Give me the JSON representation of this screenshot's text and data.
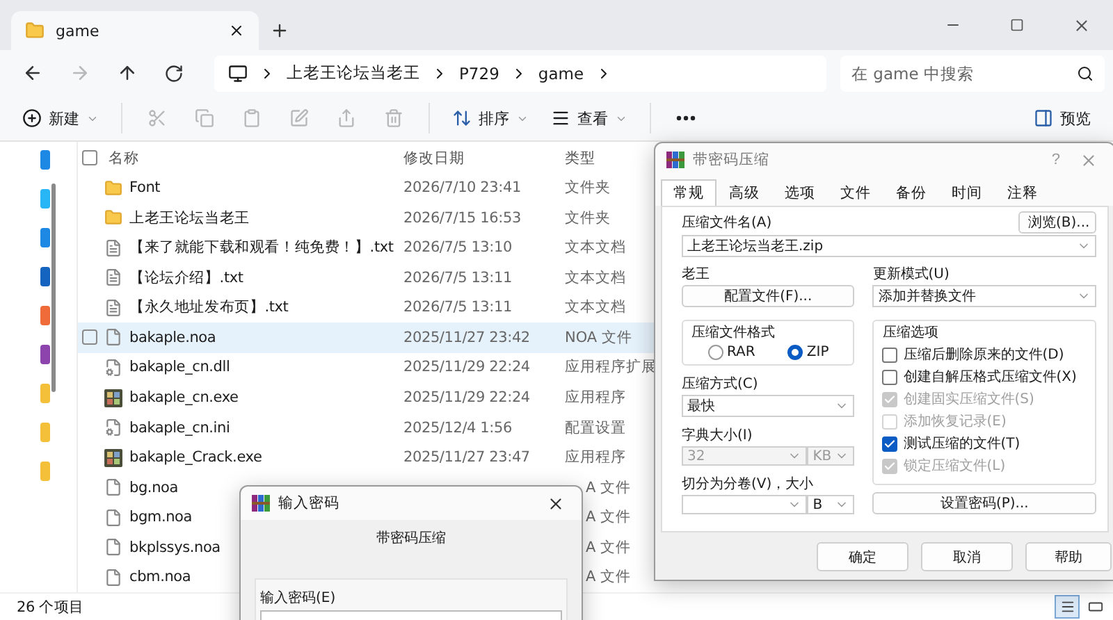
{
  "explorer": {
    "tab": {
      "title": "game"
    },
    "breadcrumb": [
      "上老王论坛当老王",
      "P729",
      "game"
    ],
    "search": {
      "placeholder": "在 game 中搜索"
    },
    "toolbar": {
      "new": "新建",
      "sort": "排序",
      "view": "查看",
      "preview": "预览"
    },
    "nav_pane": [
      {
        "color": "#1e88e5"
      },
      {
        "color": "#29b6f6"
      },
      {
        "color": "#1e88e5"
      },
      {
        "color": "#1565c0"
      },
      {
        "color": "#ef6c3a"
      },
      {
        "color": "#8e44ad"
      },
      {
        "color": "#f4c03a"
      },
      {
        "color": "#f4c03a"
      },
      {
        "color": "#f4c03a"
      }
    ],
    "select_all": {
      "checked": false
    },
    "columns": [
      "名称",
      "修改日期",
      "类型"
    ],
    "files": [
      {
        "kind": "folder",
        "name": "Font",
        "date": "2026/7/10 23:41",
        "type": "文件夹",
        "selected": false
      },
      {
        "kind": "folder",
        "name": "上老王论坛当老王",
        "date": "2026/7/15 16:53",
        "type": "文件夹",
        "selected": false
      },
      {
        "kind": "text",
        "name": "【来了就能下载和观看！纯免费！】.txt",
        "date": "2026/7/5 13:10",
        "type": "文本文档",
        "selected": false
      },
      {
        "kind": "text",
        "name": "【论坛介绍】.txt",
        "date": "2026/7/5 13:11",
        "type": "文本文档",
        "selected": false
      },
      {
        "kind": "text",
        "name": "【永久地址发布页】.txt",
        "date": "2026/7/5 13:11",
        "type": "文本文档",
        "selected": false
      },
      {
        "kind": "file",
        "name": "bakaple.noa",
        "date": "2025/11/27 23:42",
        "type": "NOA 文件",
        "selected": true
      },
      {
        "kind": "config",
        "name": "bakaple_cn.dll",
        "date": "2025/11/29 22:24",
        "type": "应用程序扩展",
        "selected": false
      },
      {
        "kind": "app",
        "name": "bakaple_cn.exe",
        "date": "2025/11/29 22:24",
        "type": "应用程序",
        "selected": false
      },
      {
        "kind": "config",
        "name": "bakaple_cn.ini",
        "date": "2025/12/4 1:56",
        "type": "配置设置",
        "selected": false
      },
      {
        "kind": "app",
        "name": "bakaple_Crack.exe",
        "date": "2025/11/27 23:47",
        "type": "应用程序",
        "selected": false
      },
      {
        "kind": "file",
        "name": "bg.noa",
        "type": "A 文件",
        "selected": false
      },
      {
        "kind": "file",
        "name": "bgm.noa",
        "type": "A 文件",
        "selected": false
      },
      {
        "kind": "file",
        "name": "bkplssys.noa",
        "type": "A 文件",
        "selected": false
      },
      {
        "kind": "file",
        "name": "cbm.noa",
        "type": "A 文件",
        "selected": false
      }
    ],
    "status": "26 个项目",
    "view_buttons": [
      {
        "kind": "details",
        "selected": true
      },
      {
        "kind": "tiles",
        "selected": false
      }
    ]
  },
  "archive_dialog": {
    "title": "带密码压缩",
    "help": "?",
    "tabs": [
      {
        "label": "常规",
        "selected": true
      },
      {
        "label": "高级",
        "selected": false
      },
      {
        "label": "选项",
        "selected": false
      },
      {
        "label": "文件",
        "selected": false
      },
      {
        "label": "备份",
        "selected": false
      },
      {
        "label": "时间",
        "selected": false
      },
      {
        "label": "注释",
        "selected": false
      }
    ],
    "archive_name": {
      "label": "压缩文件名(A)",
      "value": "上老王论坛当老王.zip",
      "browse": "浏览(B)..."
    },
    "profile": {
      "label": "老王",
      "button": "配置文件(F)..."
    },
    "update_mode": {
      "label": "更新模式(U)",
      "value": "添加并替换文件"
    },
    "format": {
      "label": "压缩文件格式",
      "options": [
        {
          "label": "RAR",
          "selected": false
        },
        {
          "label": "ZIP",
          "selected": true
        }
      ]
    },
    "method": {
      "label": "压缩方式(C)",
      "value": "最快"
    },
    "dictionary": {
      "label": "字典大小(I)",
      "value": "32",
      "unit": "KB",
      "disabled": true
    },
    "split": {
      "label": "切分为分卷(V)，大小",
      "unit": "B"
    },
    "options": {
      "label": "压缩选项",
      "items": [
        {
          "label": "压缩后删除原来的文件(D)",
          "checked": false,
          "disabled": false
        },
        {
          "label": "创建自解压格式压缩文件(X)",
          "checked": false,
          "disabled": false
        },
        {
          "label": "创建固实压缩文件(S)",
          "checked": true,
          "disabled": true
        },
        {
          "label": "添加恢复记录(E)",
          "checked": false,
          "disabled": true
        },
        {
          "label": "测试压缩的文件(T)",
          "checked": true,
          "disabled": false
        },
        {
          "label": "锁定压缩文件(L)",
          "checked": true,
          "disabled": true
        }
      ]
    },
    "set_password": "设置密码(P)...",
    "buttons": [
      "确定",
      "取消",
      "帮助"
    ]
  },
  "password_dialog": {
    "title": "输入密码",
    "subtitle": "带密码压缩",
    "field_label": "输入密码(E)"
  }
}
